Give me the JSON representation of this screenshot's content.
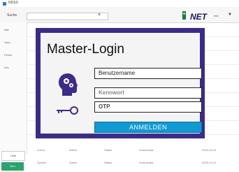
{
  "window": {
    "title": "NDSS"
  },
  "toolbar": {
    "search_label": "Suche",
    "close_symbol": "×",
    "brand": "NET",
    "about": "Info",
    "pin_symbol": "▼"
  },
  "left_pane": {
    "items": [
      "Alle",
      "Jobs",
      "Fehler",
      "Info"
    ]
  },
  "footer": {
    "rows": [
      [
        "Lizenz",
        "Admin",
        "Status",
        "Kommentar",
        "2023-10-21"
      ],
      [
        "System",
        "Admin",
        "Status",
        "Kommentar",
        "2023-10-21"
      ]
    ]
  },
  "bottom_tabs": {
    "tab_a": "Liste",
    "tab_b": "Neu"
  },
  "login": {
    "title": "Master-Login",
    "username_placeholder": "Benutzername",
    "password_placeholder": "Kennwort",
    "otp_placeholder": "OTP",
    "submit_label": "ANMELDEN"
  },
  "icons": {
    "user": "user-gears-icon",
    "key": "key-icon"
  },
  "colors": {
    "modal_border": "#3b2b8c",
    "button": "#0e9bd3",
    "brand": "#1b1b5e"
  }
}
